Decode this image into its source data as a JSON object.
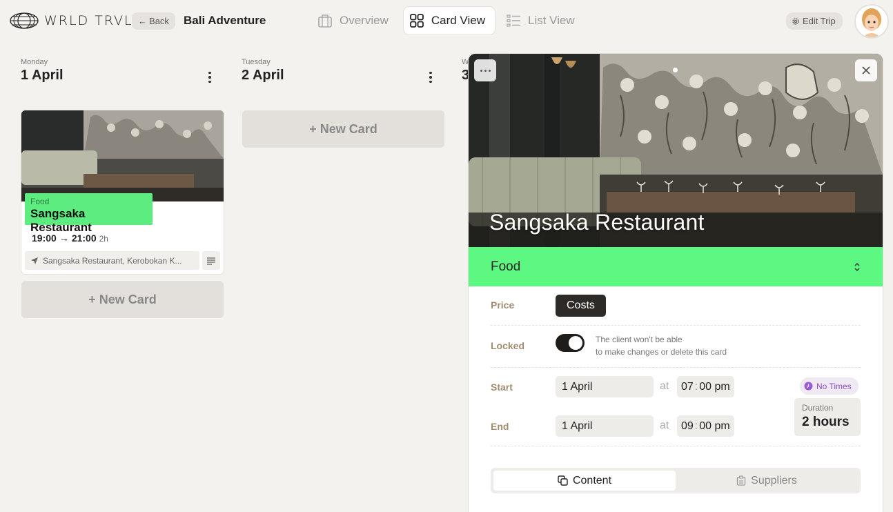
{
  "header": {
    "logo_text": "WRLD TRVL",
    "back_label": "Back",
    "trip_title": "Bali Adventure",
    "tabs": [
      {
        "label": "Overview",
        "icon": "suitcase-icon"
      },
      {
        "label": "Card View",
        "icon": "grid-icon",
        "active": true
      },
      {
        "label": "List View",
        "icon": "list-icon"
      }
    ],
    "edit_trip_label": "Edit Trip"
  },
  "columns": [
    {
      "day": "Monday",
      "date": "1 April"
    },
    {
      "day": "Tuesday",
      "date": "2 April"
    },
    {
      "day": "W",
      "date": "3"
    }
  ],
  "card": {
    "category": "Food",
    "name": "Sangsaka Restaurant",
    "start": "19:00",
    "arrow": "→",
    "end": "21:00",
    "duration": "2h",
    "location": "Sangsaka Restaurant, Kerobokan K..."
  },
  "new_card_label": "+ New Card",
  "detail": {
    "title": "Sangsaka Restaurant",
    "category": "Food",
    "price_label": "Price",
    "costs_label": "Costs",
    "locked_label": "Locked",
    "locked_on": true,
    "locked_note_1": "The client won't be able",
    "locked_note_2": "to make changes or delete this card",
    "start_label": "Start",
    "end_label": "End",
    "at_label": "at",
    "start_date": "1 April",
    "start_hh": "07",
    "start_mm": "00 pm",
    "end_date": "1 April",
    "end_hh": "09",
    "end_mm": "00 pm",
    "no_times_label": "No Times",
    "duration_label": "Duration",
    "duration_value": "2 hours",
    "tabs": [
      {
        "label": "Content",
        "icon": "content-icon",
        "active": true
      },
      {
        "label": "Suppliers",
        "icon": "clipboard-icon"
      }
    ]
  },
  "colors": {
    "category_green": "#5cf882",
    "background": "#f3f2ef",
    "no_times_purple": "#8b4fc3"
  }
}
